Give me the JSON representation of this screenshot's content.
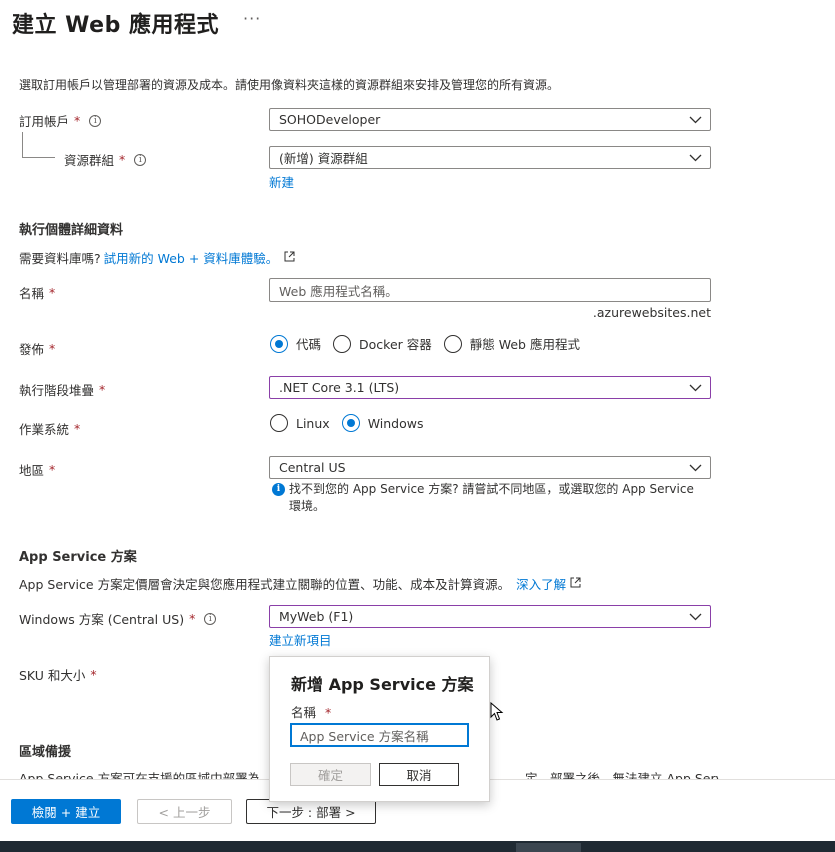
{
  "page": {
    "title": "建立 Web 應用程式",
    "more": "···",
    "description": "選取訂用帳戶以管理部署的資源及成本。請使用像資料夾這樣的資源群組來安排及管理您的所有資源。"
  },
  "project": {
    "subscription_label": "訂用帳戶",
    "subscription_value": "SOHODeveloper",
    "resource_group_label": "資源群組",
    "resource_group_value": "(新增) 資源群組",
    "resource_group_new_link": "新建"
  },
  "instance": {
    "section_title": "執行個體詳細資料",
    "db_prompt": "需要資料庫嗎?",
    "db_link": "試用新的 Web + 資料庫體驗。",
    "name_label": "名稱",
    "name_placeholder": "Web 應用程式名稱。",
    "name_suffix": ".azurewebsites.net",
    "publish_label": "發佈",
    "publish_options": [
      "代碼",
      "Docker 容器",
      "靜態 Web 應用程式"
    ],
    "publish_selected": "代碼",
    "runtime_label": "執行階段堆疊",
    "runtime_value": ".NET Core 3.1 (LTS)",
    "os_label": "作業系統",
    "os_options": [
      "Linux",
      "Windows"
    ],
    "os_selected": "Windows",
    "region_label": "地區",
    "region_value": "Central US",
    "region_note_line1": "找不到您的 App Service 方案? 請嘗試不同地區，或選取您的 App Service",
    "region_note_line2": "環境。"
  },
  "plan": {
    "section_title": "App Service 方案",
    "description": "App Service 方案定價層會決定與您應用程式建立關聯的位置、功能、成本及計算資源。",
    "learn_more": "深入了解",
    "windows_plan_label": "Windows 方案 (Central US)",
    "windows_plan_value": "MyWeb (F1)",
    "create_new_link": "建立新項目",
    "sku_label": "SKU 和大小"
  },
  "zone": {
    "section_title": "區域備援",
    "clipped_text_left": "App Service 方案可在支援的區域中部署為",
    "clipped_text_right": "定。部署之後，無法建立 App Service"
  },
  "popup": {
    "title": "新增 App Service 方案",
    "name_label": "名稱",
    "name_placeholder": "App Service 方案名稱",
    "ok_label": "確定",
    "cancel_label": "取消"
  },
  "footer": {
    "review_create": "檢閱 + 建立",
    "previous": "< 上一步",
    "next": "下一步 : 部署 >"
  },
  "colors": {
    "accent": "#0078d4",
    "required": "#a4262c",
    "focus_border": "#8a3fa8"
  }
}
